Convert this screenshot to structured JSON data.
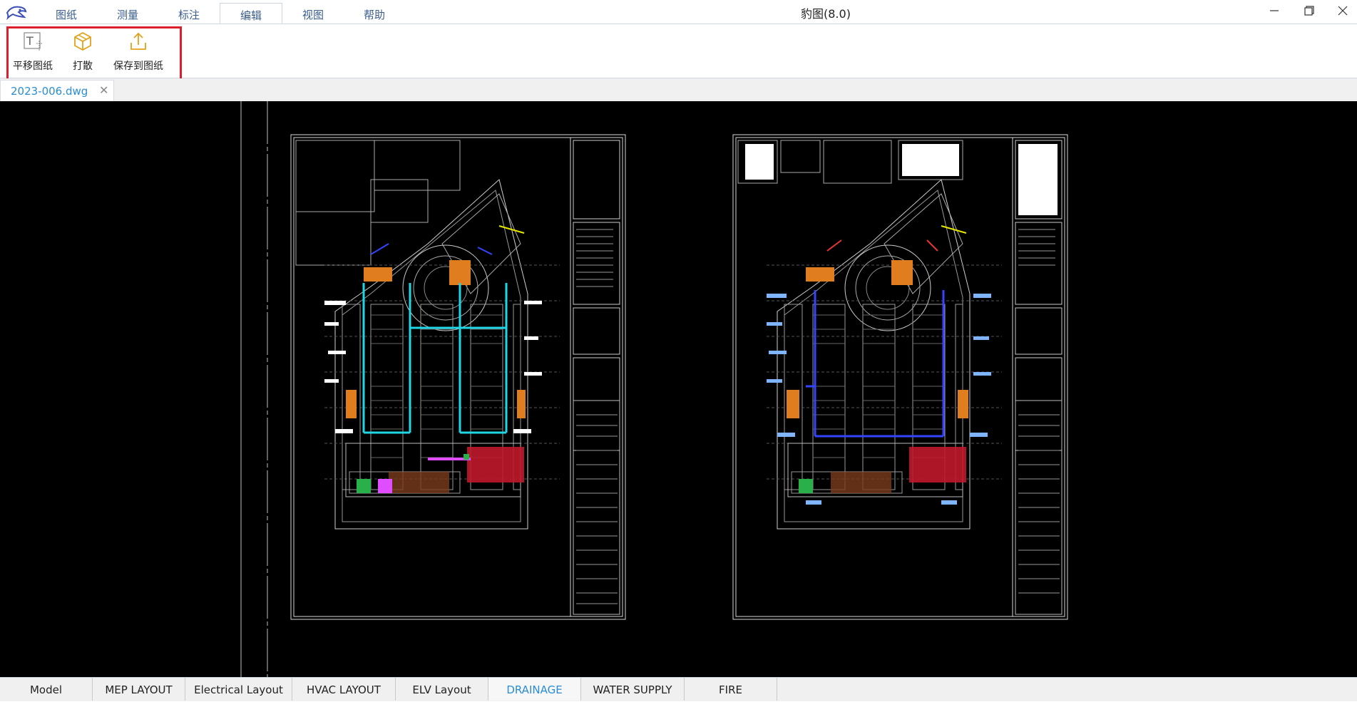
{
  "app": {
    "title": "豹图(8.0)"
  },
  "menu": {
    "tabs": [
      "图纸",
      "测量",
      "标注",
      "编辑",
      "视图",
      "帮助"
    ],
    "active": "编辑"
  },
  "ribbon": {
    "buttons": [
      {
        "label": "平移图纸",
        "icon": "move-drawing-icon"
      },
      {
        "label": "打散",
        "icon": "explode-icon"
      },
      {
        "label": "保存到图纸",
        "icon": "save-to-drawing-icon"
      }
    ]
  },
  "document": {
    "tab_label": "2023-006.dwg",
    "close_glyph": "✕"
  },
  "layouts": {
    "tabs": [
      "Model",
      "MEP LAYOUT",
      "Electrical Layout",
      "HVAC LAYOUT",
      "ELV Layout",
      "DRAINAGE",
      "WATER SUPPLY",
      "FIRE"
    ],
    "active": "DRAINAGE"
  },
  "colors": {
    "accent": "#2a8dd4",
    "highlight": "#d9202b",
    "canvas": "#000000"
  }
}
